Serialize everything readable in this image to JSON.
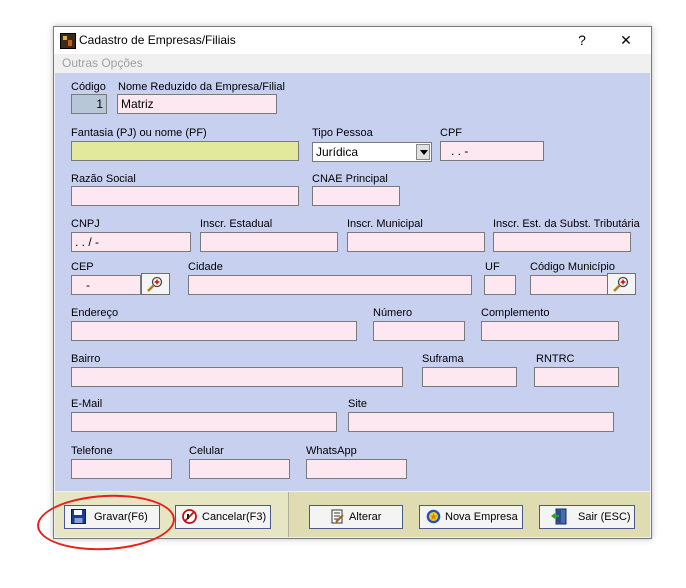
{
  "window": {
    "title": "Cadastro de Empresas/Filiais",
    "help_glyph": "?",
    "close_glyph": "✕"
  },
  "menu": {
    "outras_opcoes": "Outras Opções"
  },
  "form": {
    "codigo": {
      "label": "Código",
      "value": "1"
    },
    "nome_reduzido": {
      "label": "Nome Reduzido da Empresa/Filial",
      "value": "Matriz"
    },
    "fantasia": {
      "label": "Fantasia (PJ) ou nome (PF)",
      "value": ""
    },
    "tipo_pessoa": {
      "label": "Tipo Pessoa",
      "value": "Jurídica"
    },
    "cpf": {
      "label": "CPF",
      "value": ". . -"
    },
    "razao_social": {
      "label": "Razão Social",
      "value": ""
    },
    "cnae": {
      "label": "CNAE Principal",
      "value": ""
    },
    "cnpj": {
      "label": "CNPJ",
      "value": ". . / -"
    },
    "inscr_estadual": {
      "label": "Inscr. Estadual",
      "value": ""
    },
    "inscr_municipal": {
      "label": "Inscr. Municipal",
      "value": ""
    },
    "inscr_subst": {
      "label": "Inscr. Est. da Subst. Tributária",
      "value": ""
    },
    "cep": {
      "label": "CEP",
      "value": "-"
    },
    "cidade": {
      "label": "Cidade",
      "value": ""
    },
    "uf": {
      "label": "UF",
      "value": ""
    },
    "codigo_municipio": {
      "label": "Código Município",
      "value": ""
    },
    "endereco": {
      "label": "Endereço",
      "value": ""
    },
    "numero": {
      "label": "Número",
      "value": ""
    },
    "complemento": {
      "label": "Complemento",
      "value": ""
    },
    "bairro": {
      "label": "Bairro",
      "value": ""
    },
    "suframa": {
      "label": "Suframa",
      "value": ""
    },
    "rntrc": {
      "label": "RNTRC",
      "value": ""
    },
    "email": {
      "label": "E-Mail",
      "value": ""
    },
    "site": {
      "label": "Site",
      "value": ""
    },
    "telefone": {
      "label": "Telefone",
      "value": ""
    },
    "celular": {
      "label": "Celular",
      "value": ""
    },
    "whatsapp": {
      "label": "WhatsApp",
      "value": ""
    }
  },
  "buttons": {
    "gravar": "Gravar(F6)",
    "cancelar": "Cancelar(F3)",
    "alterar": "Alterar",
    "nova_empresa": "Nova Empresa",
    "sair": "Sair (ESC)"
  },
  "colors": {
    "form_background": "#c8d0f0",
    "field_pink": "#fde8f2",
    "field_green": "#e2e89c",
    "field_readonly": "#b7c7d8",
    "footer": "#dedcb0",
    "annotation_red": "#e8201a"
  },
  "icons": {
    "title": "app-icon",
    "lookup": "magnifier-plus-icon",
    "gravar": "floppy-disk-icon",
    "cancelar": "cancel-icon",
    "alterar": "edit-document-icon",
    "nova_empresa": "star-badge-icon",
    "sair": "exit-door-icon"
  }
}
